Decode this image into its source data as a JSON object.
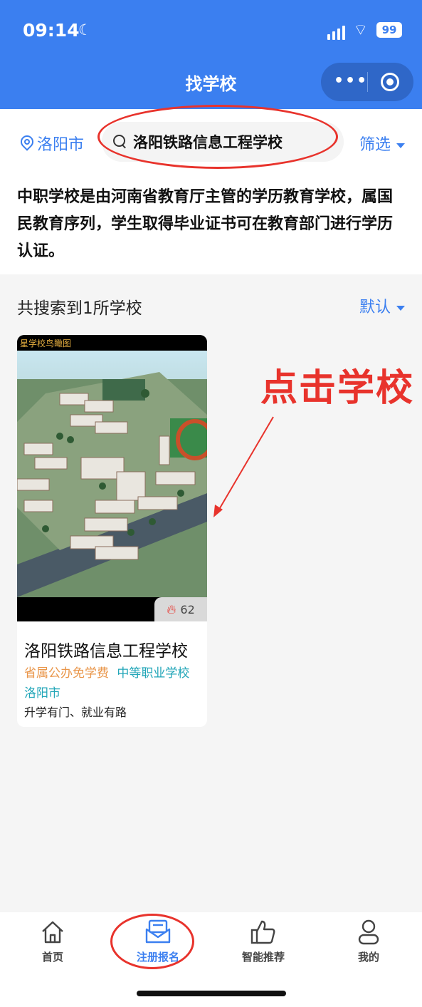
{
  "status": {
    "time": "09:14",
    "battery": "99"
  },
  "nav": {
    "title": "找学校"
  },
  "search": {
    "city": "洛阳市",
    "query": "洛阳铁路信息工程学校",
    "filter_label": "筛选"
  },
  "description": "中职学校是由河南省教育厅主管的学历教育学校，属国民教育序列，学生取得毕业证书可在教育部门进行学历认证。",
  "results": {
    "count_text": "共搜索到1所学校",
    "sort_label": "默认"
  },
  "school_card": {
    "photo_caption": "星学校鸟瞰图",
    "hot_count": "62",
    "name": "洛阳铁路信息工程学校",
    "tag_type": "省属公办免学费",
    "tag_level": "中等职业学校",
    "city": "洛阳市",
    "slogan": "升学有门、就业有路"
  },
  "annotation": {
    "text": "点击学校"
  },
  "tabbar": {
    "items": [
      {
        "label": "首页",
        "icon": "home-icon"
      },
      {
        "label": "注册报名",
        "icon": "register-icon",
        "active": true
      },
      {
        "label": "智能推荐",
        "icon": "thumbs-up-icon"
      },
      {
        "label": "我的",
        "icon": "user-icon"
      }
    ]
  },
  "colors": {
    "primary": "#3b7ff0",
    "annotation_red": "#e8332c",
    "tag_orange": "#e9964a",
    "tag_teal": "#22a6b8"
  }
}
